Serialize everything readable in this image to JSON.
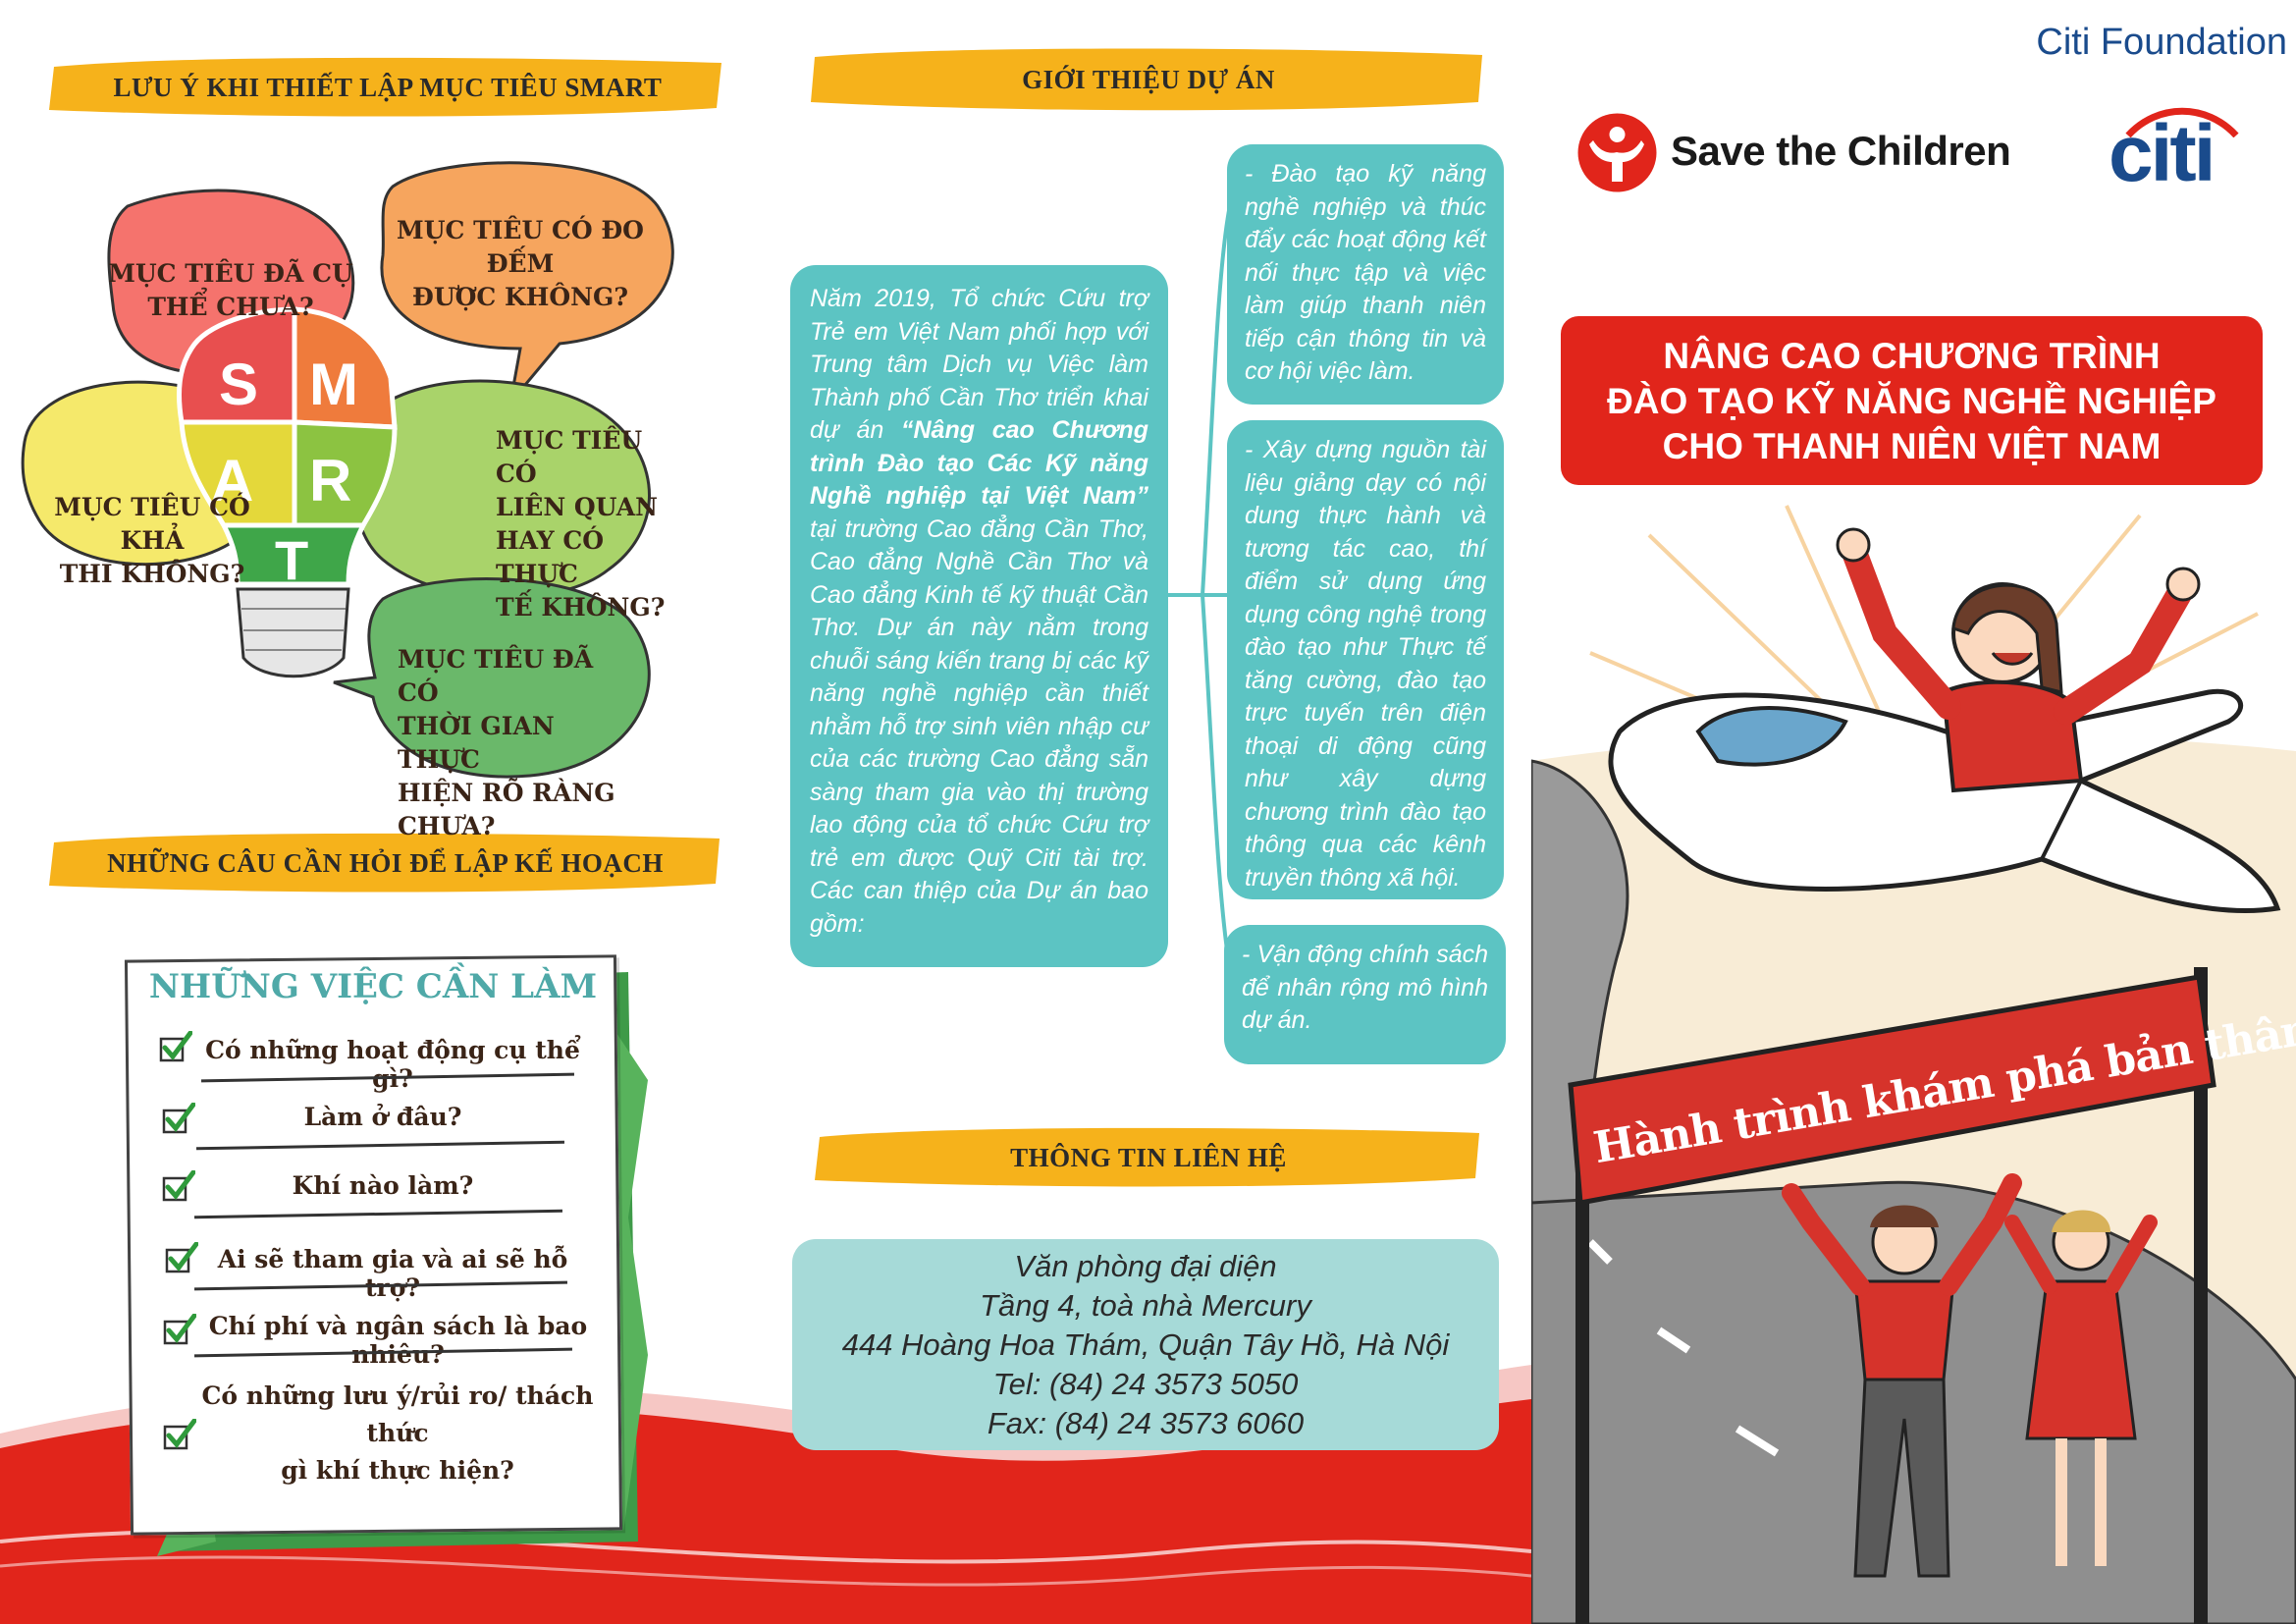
{
  "headers": {
    "smart_notes": "LƯU Ý KHI THIẾT LẬP MỤC TIÊU SMART",
    "project_intro": "GIỚI THIỆU DỰ ÁN",
    "planning_questions": "NHỮNG CÂU CẦN HỎI ĐỂ LẬP KẾ HOẠCH",
    "contact_info": "THÔNG TIN LIÊN HỆ"
  },
  "smart": {
    "letters": [
      "S",
      "M",
      "A",
      "R",
      "T"
    ],
    "bubbles": {
      "specific": [
        "MỤC TIÊU ĐÃ CỤ",
        "THỂ CHƯA?"
      ],
      "measurable": [
        "MỤC TIÊU CÓ ĐO ĐẾM",
        "ĐƯỢC KHÔNG?"
      ],
      "achievable": [
        "MỤC TIÊU CÓ KHẢ",
        "THI KHÔNG?"
      ],
      "relevant": [
        "MỤC TIÊU CÓ",
        "LIÊN QUAN",
        "HAY CÓ THỰC",
        "TẾ KHÔNG?"
      ],
      "timebound": [
        "MỤC TIÊU ĐÃ CÓ",
        "THỜI GIAN THỰC",
        "HIỆN RÕ RÀNG",
        "CHƯA?"
      ]
    }
  },
  "checklist": {
    "title": "NHỮNG VIỆC CẦN LÀM",
    "items": [
      "Có những hoạt động cụ thể gì?",
      "Làm ở đâu?",
      "Khí nào làm?",
      "Ai sẽ tham gia và ai sẽ hỗ trợ?",
      "Chí phí và ngân sách là bao nhiêu?",
      "Có những lưu ý/rủi ro/ thách thức",
      "gì khí thực hiện?"
    ]
  },
  "intro": {
    "text_before": "Năm 2019, Tổ chức Cứu trợ Trẻ em Việt Nam phối hợp với Trung tâm Dịch vụ Việc làm Thành phố Cần Thơ triển khai dự án ",
    "text_bold": "“Nâng cao Chương trình Đào tạo Các Kỹ năng Nghề nghiệp tại Việt Nam”",
    "text_after": " tại trường Cao đẳng Cần Thơ, Cao đẳng Nghề Cần Thơ và Cao đẳng Kinh tế kỹ thuật Cần Thơ. Dự án này nằm trong chuỗi sáng kiến trang bị các kỹ năng nghề nghiệp cần thiết nhằm hỗ trợ sinh viên nhập cư của các trường Cao đẳng sẵn sàng tham gia vào thị trường lao động của tổ chức Cứu trợ trẻ em được Quỹ Citi tài trợ. Các can thiệp của Dự án bao gồm:"
  },
  "interventions": [
    "- Đào tạo kỹ năng nghề nghiệp và thúc đẩy các hoạt động kết nối thực tập và việc làm giúp thanh niên tiếp cận thông tin và cơ hội việc làm.",
    "- Xây dựng nguồn tài liệu giảng dạy có nội dung thực hành và tương tác cao, thí điểm sử dụng ứng dụng công nghệ trong đào tạo như Thực tế tăng cường, đào tạo trực tuyến trên điện thoại di động cũng như xây dựng chương trình đào tạo thông qua các kênh truyền thông xã hội.",
    "- Vận động chính sách để nhân rộng mô hình dự án."
  ],
  "contact": {
    "lines": [
      "Văn phòng đại diện",
      "Tầng 4, toà nhà Mercury",
      "444 Hoàng Hoa Thám, Quận Tây Hồ, Hà Nội",
      "Tel: (84) 24 3573 5050",
      "Fax: (84) 24 3573 6060"
    ]
  },
  "logos": {
    "citi_foundation": "Citi Foundation",
    "save_the_children": "Save the Children",
    "citi": "citi"
  },
  "cover": {
    "title_lines": [
      "NÂNG CAO CHƯƠNG TRÌNH",
      "ĐÀO TẠO KỸ NĂNG NGHỀ NGHIỆP",
      "CHO THANH NIÊN VIỆT NAM"
    ],
    "banner": "Hành trình khám phá bản thân"
  },
  "colors": {
    "brand_red": "#e1251b",
    "teal": "#5cc4c3",
    "teal_light": "#a6dad8",
    "yellow": "#f6b21b",
    "citi_blue": "#1a4b8c"
  }
}
